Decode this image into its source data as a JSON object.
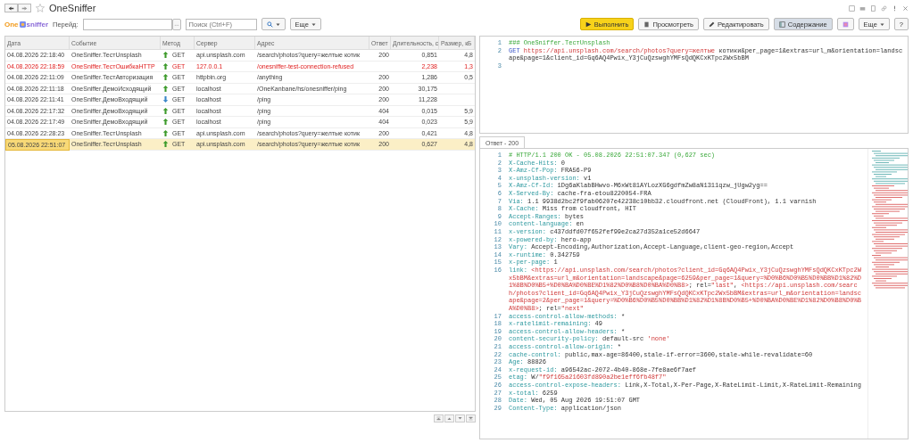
{
  "window": {
    "title": "OneSniffer",
    "favorite": false
  },
  "logo": {
    "part_1": "One",
    "part_2": "sniffer"
  },
  "toolbar": {
    "goto_label": "Перейд:",
    "search_placeholder": "Поиск (Ctrl+F)",
    "more": "Еще",
    "more_right": "Еще",
    "help": "?"
  },
  "actions": [
    {
      "kind": "run",
      "label": "Выполнить",
      "pressed": false
    },
    {
      "kind": "view",
      "label": "Просмотреть",
      "pressed": false
    },
    {
      "kind": "edit",
      "label": "Редактировать",
      "pressed": false
    },
    {
      "kind": "contents",
      "label": "Содержание",
      "pressed": true
    }
  ],
  "table": {
    "columns": [
      "Дата",
      "Событие",
      "Метод",
      "Сервер",
      "Адрес",
      "Ответ",
      "Длительность, с",
      "Размер, кБ"
    ],
    "rows": [
      {
        "date": "04.08.2026 22:18:40",
        "event": "OneSniffer.ТестUnsplash",
        "incoming": false,
        "method": "GET",
        "server": "api.unsplash.com",
        "address": "/search/photos?query=желтые котик",
        "status": "200",
        "duration": "0,851",
        "size": "4,8",
        "error": false,
        "selected": false
      },
      {
        "date": "04.08.2026 22:18:59",
        "event": "OneSniffer.ТестОшибкаHTTP",
        "incoming": false,
        "method": "GET",
        "server": "127.0.0.1",
        "address": "/onesniffer-test-connection-refused",
        "status": "",
        "duration": "2,238",
        "size": "1,3",
        "error": true,
        "selected": false
      },
      {
        "date": "04.08.2026 22:11:09",
        "event": "OneSniffer.ТестАвторизация",
        "incoming": false,
        "method": "GET",
        "server": "httpbin.org",
        "address": "/anything",
        "status": "200",
        "duration": "1,286",
        "size": "0,5",
        "error": false,
        "selected": false
      },
      {
        "date": "04.08.2026 22:11:18",
        "event": "OneSniffer.ДемоИсходящий",
        "incoming": false,
        "method": "GET",
        "server": "localhost",
        "address": "/OneKanbane/hs/onesniffer/ping",
        "status": "200",
        "duration": "30,175",
        "size": "",
        "error": false,
        "selected": false
      },
      {
        "date": "04.08.2026 22:11:41",
        "event": "OneSniffer.ДемоВходящий",
        "incoming": true,
        "method": "GET",
        "server": "localhost",
        "address": "/ping",
        "status": "200",
        "duration": "11,228",
        "size": "",
        "error": false,
        "selected": false
      },
      {
        "date": "04.08.2026 22:17:32",
        "event": "OneSniffer.ДемоВходящий",
        "incoming": false,
        "method": "GET",
        "server": "localhost",
        "address": "/ping",
        "status": "404",
        "duration": "0,015",
        "size": "5,9",
        "error": false,
        "selected": false
      },
      {
        "date": "04.08.2026 22:17:49",
        "event": "OneSniffer.ДемоВходящий",
        "incoming": false,
        "method": "GET",
        "server": "localhost",
        "address": "/ping",
        "status": "404",
        "duration": "0,023",
        "size": "5,9",
        "error": false,
        "selected": false
      },
      {
        "date": "04.08.2026 22:28:23",
        "event": "OneSniffer.ТестUnsplash",
        "incoming": false,
        "method": "GET",
        "server": "api.unsplash.com",
        "address": "/search/photos?query=желтые котик",
        "status": "200",
        "duration": "0,421",
        "size": "4,8",
        "error": false,
        "selected": false
      },
      {
        "date": "05.08.2026 22:51:07",
        "event": "OneSniffer.ТестUnsplash",
        "incoming": false,
        "method": "GET",
        "server": "api.unsplash.com",
        "address": "/search/photos?query=желтые котик",
        "status": "200",
        "duration": "0,627",
        "size": "4,8",
        "error": false,
        "selected": true
      }
    ]
  },
  "request_editor": {
    "lines": [
      {
        "num": "1",
        "parts": [
          {
            "kind": "comment",
            "text": "### OneSniffer.ТестUnsplash"
          }
        ]
      },
      {
        "num": "2",
        "parts": [
          {
            "kind": "method",
            "text": "GET"
          },
          {
            "kind": "string",
            "text": " https://api.unsplash.com/search/photos?query=желтые"
          },
          {
            "kind": "plain",
            "text": " котики&per_page=1&extras=url_m&orientation=landscape&page=1&client_id=Gq6AQ4Pwix_Y3jCuQzswghYMFsQdQKCxKTpc2Wx5bBM"
          }
        ]
      },
      {
        "num": "3"
      }
    ]
  },
  "response_tab": {
    "label": "Ответ - 200",
    "selected": true
  },
  "response_editor": {
    "lines": [
      {
        "num": "1",
        "parts": [
          {
            "kind": "comment",
            "text": "# HTTP/1.1 200 OK - 05.08.2026 22:51:07.347 (0,627 sec)"
          }
        ]
      },
      {
        "num": "2",
        "parts": [
          {
            "kind": "key",
            "text": "X-Cache-Hits:"
          },
          {
            "kind": "plain",
            "text": " 0"
          }
        ]
      },
      {
        "num": "3",
        "parts": [
          {
            "kind": "key",
            "text": "X-Amz-Cf-Pop:"
          },
          {
            "kind": "plain",
            "text": " FRA56-P9"
          }
        ]
      },
      {
        "num": "4",
        "parts": [
          {
            "kind": "key",
            "text": "x-unsplash-version:"
          },
          {
            "kind": "plain",
            "text": " v1"
          }
        ]
      },
      {
        "num": "5",
        "parts": [
          {
            "kind": "key",
            "text": "X-Amz-Cf-Id:"
          },
          {
            "kind": "plain",
            "text": " 1Dg6aKlabBHwvo-M6xWt81AYLozXG6gdfmZw8aN1311qzw_jUgw2yg=="
          }
        ]
      },
      {
        "num": "6",
        "parts": [
          {
            "kind": "key",
            "text": "X-Served-By:"
          },
          {
            "kind": "plain",
            "text": " cache-fra-etou8220054-FRA"
          }
        ]
      },
      {
        "num": "7",
        "parts": [
          {
            "kind": "key",
            "text": "Via:"
          },
          {
            "kind": "plain",
            "text": " 1.1 9938d2bc2f9fab06207e42238c10bb32.cloudfront.net (CloudFront), 1.1 varnish"
          }
        ]
      },
      {
        "num": "8",
        "parts": [
          {
            "kind": "key",
            "text": "X-Cache:"
          },
          {
            "kind": "plain",
            "text": " Miss from cloudfront, HIT"
          }
        ]
      },
      {
        "num": "9",
        "parts": [
          {
            "kind": "key",
            "text": "Accept-Ranges:"
          },
          {
            "kind": "plain",
            "text": " bytes"
          }
        ]
      },
      {
        "num": "10",
        "parts": [
          {
            "kind": "key",
            "text": "content-language:"
          },
          {
            "kind": "plain",
            "text": " en"
          }
        ]
      },
      {
        "num": "11",
        "parts": [
          {
            "kind": "key",
            "text": "x-version:"
          },
          {
            "kind": "plain",
            "text": " c437ddfd07f652fef99e2ca27d352a1ce52d6647"
          }
        ]
      },
      {
        "num": "12",
        "parts": [
          {
            "kind": "key",
            "text": "x-powered-by:"
          },
          {
            "kind": "plain",
            "text": " hero-app"
          }
        ]
      },
      {
        "num": "13",
        "parts": [
          {
            "kind": "key",
            "text": "Vary:"
          },
          {
            "kind": "plain",
            "text": " Accept-Encoding,Authorization,Accept-Language,client-geo-region,Accept"
          }
        ]
      },
      {
        "num": "14",
        "parts": [
          {
            "kind": "key",
            "text": "x-runtime:"
          },
          {
            "kind": "plain",
            "text": " 0.342759"
          }
        ]
      },
      {
        "num": "15",
        "parts": [
          {
            "kind": "key",
            "text": "x-per-page:"
          },
          {
            "kind": "plain",
            "text": " 1"
          }
        ]
      },
      {
        "num": "16",
        "parts": [
          {
            "kind": "key",
            "text": "link:"
          },
          {
            "kind": "string",
            "text": " <https://api.unsplash.com/search/photos?client_id=Gq6AQ4Pwix_Y3jCuQzswghYMFsQdQKCxKTpc2Wx5bBM&extras=url_m&orientation=landscape&page=6259&per_page=1&query=%D0%B6%D0%B5%D0%BB%D1%82%D1%8B%D0%B5+%D0%BA%D0%BE%D1%82%D0%B8%D0%BA%D0%B8>"
          },
          {
            "kind": "plain",
            "text": "; rel="
          },
          {
            "kind": "string",
            "text": "\"last\""
          },
          {
            "kind": "plain",
            "text": ", "
          },
          {
            "kind": "string",
            "text": "<https://api.unsplash.com/search/photos?client_id=Gq6AQ4Pwix_Y3jCuQzswghYMFsQdQKCxKTpc2Wx5bBM&extras=url_m&orientation=landscape&page=2&per_page=1&query=%D0%B6%D0%B5%D0%BB%D1%82%D1%8B%D0%B5+%D0%BA%D0%BE%D1%82%D0%B8%D0%BA%D0%B8>"
          },
          {
            "kind": "plain",
            "text": "; rel="
          },
          {
            "kind": "string",
            "text": "\"next\""
          }
        ]
      },
      {
        "num": "17",
        "parts": [
          {
            "kind": "key",
            "text": "access-control-allow-methods:"
          },
          {
            "kind": "plain",
            "text": " *"
          }
        ]
      },
      {
        "num": "18",
        "parts": [
          {
            "kind": "key",
            "text": "x-ratelimit-remaining:"
          },
          {
            "kind": "plain",
            "text": " 49"
          }
        ]
      },
      {
        "num": "19",
        "parts": [
          {
            "kind": "key",
            "text": "access-control-allow-headers:"
          },
          {
            "kind": "plain",
            "text": " *"
          }
        ]
      },
      {
        "num": "20",
        "parts": [
          {
            "kind": "key",
            "text": "content-security-policy:"
          },
          {
            "kind": "plain",
            "text": " default-src "
          },
          {
            "kind": "string",
            "text": "'none'"
          }
        ]
      },
      {
        "num": "21",
        "parts": [
          {
            "kind": "key",
            "text": "access-control-allow-origin:"
          },
          {
            "kind": "plain",
            "text": " *"
          }
        ]
      },
      {
        "num": "22",
        "parts": [
          {
            "kind": "key",
            "text": "cache-control:"
          },
          {
            "kind": "plain",
            "text": " public,max-age=86400,stale-if-error=3600,stale-while-revalidate=60"
          }
        ]
      },
      {
        "num": "23",
        "parts": [
          {
            "kind": "key",
            "text": "Age:"
          },
          {
            "kind": "plain",
            "text": " 88826"
          }
        ]
      },
      {
        "num": "24",
        "parts": [
          {
            "kind": "key",
            "text": "x-request-id:"
          },
          {
            "kind": "plain",
            "text": " a96542ac-2072-4b40-868e-7fe8ae6f7aef"
          }
        ]
      },
      {
        "num": "25",
        "parts": [
          {
            "kind": "key",
            "text": "etag:"
          },
          {
            "kind": "plain",
            "text": " W/"
          },
          {
            "kind": "string",
            "text": "\"f9f165a21603fd890a2be1eff6fb48f7\""
          }
        ]
      },
      {
        "num": "26",
        "parts": [
          {
            "kind": "key",
            "text": "access-control-expose-headers:"
          },
          {
            "kind": "plain",
            "text": " Link,X-Total,X-Per-Page,X-RateLimit-Limit,X-RateLimit-Remaining"
          }
        ]
      },
      {
        "num": "27",
        "parts": [
          {
            "kind": "key",
            "text": "x-total:"
          },
          {
            "kind": "plain",
            "text": " 6259"
          }
        ]
      },
      {
        "num": "28",
        "parts": [
          {
            "kind": "key",
            "text": "Date:"
          },
          {
            "kind": "plain",
            "text": " Wed, 05 Aug 2026 19:51:07 GMT"
          }
        ]
      },
      {
        "num": "29",
        "parts": [
          {
            "kind": "key",
            "text": "Content-Type:"
          },
          {
            "kind": "plain",
            "text": " application/json"
          }
        ]
      }
    ]
  }
}
